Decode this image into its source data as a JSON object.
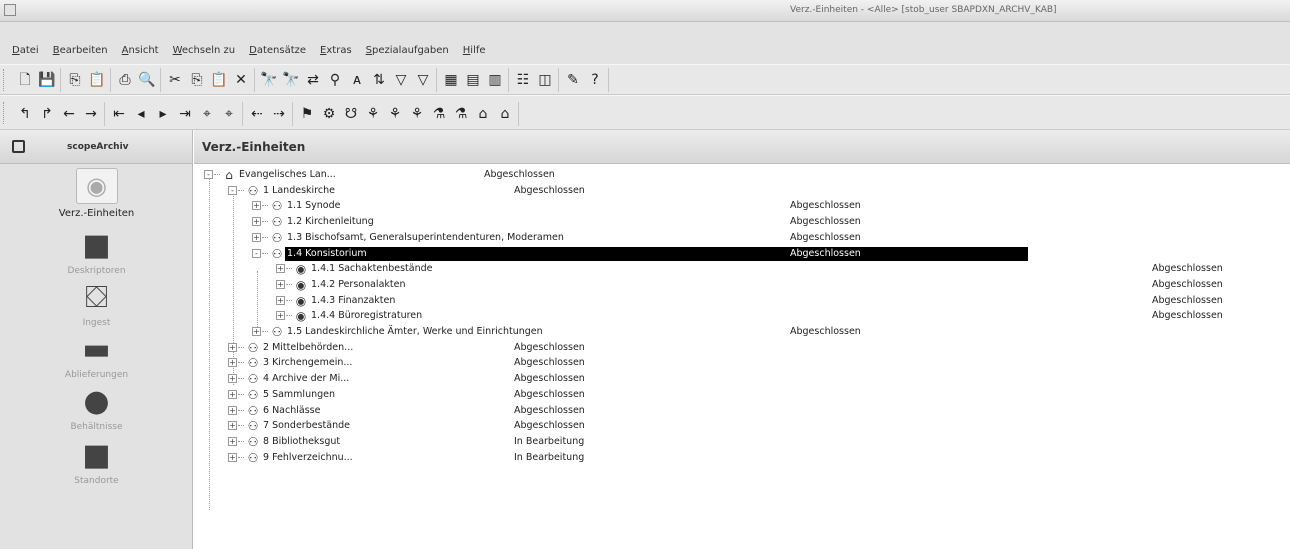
{
  "window": {
    "title": "Verz.-Einheiten - <Alle> [stob_user SBAPDXN_ARCHV_KAB]"
  },
  "menu": [
    "Datei",
    "Bearbeiten",
    "Ansicht",
    "Wechseln zu",
    "Datensätze",
    "Extras",
    "Spezialaufgaben",
    "Hilfe"
  ],
  "toolbar1": {
    "groups": [
      [
        "new-icon",
        "save-icon"
      ],
      [
        "copy-icon",
        "paste-icon"
      ],
      [
        "print-icon",
        "preview-icon"
      ],
      [
        "cut-icon",
        "copy2-icon",
        "paste2-icon",
        "delete-icon"
      ],
      [
        "find-icon",
        "find-next-icon",
        "replace-icon",
        "filter-icon",
        "find-special-icon",
        "sort-icon",
        "filter2-icon",
        "filter3-icon"
      ],
      [
        "view1-icon",
        "view2-icon",
        "view3-icon"
      ],
      [
        "properties-icon",
        "window-icon"
      ],
      [
        "tool-icon",
        "help-icon"
      ]
    ]
  },
  "toolbar2": {
    "groups": [
      [
        "level-up-icon",
        "level-down-icon",
        "arrow-left-icon",
        "arrow-right-icon"
      ],
      [
        "first-icon",
        "prev-icon",
        "next-icon",
        "last-icon",
        "goto-icon",
        "goto2-icon"
      ],
      [
        "back-icon",
        "forward-icon"
      ],
      [
        "tool1-icon",
        "tool2-icon",
        "tool3-icon",
        "tool4-icon",
        "tool5-icon",
        "tool6-icon",
        "tool7-icon",
        "tool8-icon",
        "tool9-icon",
        "tool10-icon"
      ]
    ]
  },
  "sidebar": {
    "header": "scopeArchiv",
    "items": [
      {
        "label": "Verz.-Einheiten",
        "active": true
      },
      {
        "label": "Deskriptoren",
        "active": false
      },
      {
        "label": "Ingest",
        "active": false
      },
      {
        "label": "Ablieferungen",
        "active": false
      },
      {
        "label": "Behältnisse",
        "active": false
      },
      {
        "label": "Standorte",
        "active": false
      }
    ]
  },
  "main": {
    "title": "Verz.-Einheiten",
    "rows": [
      {
        "label": "Evangelisches Lan...",
        "status": "Abgeschlossen",
        "level": 0,
        "expander": "-",
        "icon": "archive"
      },
      {
        "label": "1  Landeskirche",
        "status": "Abgeschlossen",
        "level": 1,
        "expander": "-",
        "icon": "group"
      },
      {
        "label": "1.1  Synode",
        "status": "Abgeschlossen",
        "level": 2,
        "expander": "+",
        "icon": "group"
      },
      {
        "label": "1.2  Kirchenleitung",
        "status": "Abgeschlossen",
        "level": 2,
        "expander": "+",
        "icon": "group"
      },
      {
        "label": "1.3  Bischofsamt, Generalsuperintendenturen, Moderamen",
        "status": "Abgeschlossen",
        "level": 2,
        "expander": "+",
        "icon": "group"
      },
      {
        "label": "1.4  Konsistorium",
        "status": "Abgeschlossen",
        "level": 2,
        "expander": "-",
        "icon": "group",
        "selected": true
      },
      {
        "label": "1.4.1  Sachaktenbestände",
        "status": "Abgeschlossen",
        "level": 3,
        "expander": "+",
        "icon": "file"
      },
      {
        "label": "1.4.2  Personalakten",
        "status": "Abgeschlossen",
        "level": 3,
        "expander": "+",
        "icon": "file"
      },
      {
        "label": "1.4.3  Finanzakten",
        "status": "Abgeschlossen",
        "level": 3,
        "expander": "+",
        "icon": "file"
      },
      {
        "label": "1.4.4  Büroregistraturen",
        "status": "Abgeschlossen",
        "level": 3,
        "expander": "+",
        "icon": "file"
      },
      {
        "label": "1.5  Landeskirchliche Ämter, Werke und Einrichtungen",
        "status": "Abgeschlossen",
        "level": 2,
        "expander": "+",
        "icon": "group"
      },
      {
        "label": "2  Mittelbehörden...",
        "status": "Abgeschlossen",
        "level": 1,
        "expander": "+",
        "icon": "group"
      },
      {
        "label": "3  Kirchengemein...",
        "status": "Abgeschlossen",
        "level": 1,
        "expander": "+",
        "icon": "group"
      },
      {
        "label": "4  Archive der Mi...",
        "status": "Abgeschlossen",
        "level": 1,
        "expander": "+",
        "icon": "group"
      },
      {
        "label": "5  Sammlungen",
        "status": "Abgeschlossen",
        "level": 1,
        "expander": "+",
        "icon": "group"
      },
      {
        "label": "6  Nachlässe",
        "status": "Abgeschlossen",
        "level": 1,
        "expander": "+",
        "icon": "group"
      },
      {
        "label": "7  Sonderbestände",
        "status": "Abgeschlossen",
        "level": 1,
        "expander": "+",
        "icon": "group"
      },
      {
        "label": "8  Bibliotheksgut",
        "status": "In Bearbeitung",
        "level": 1,
        "expander": "+",
        "icon": "group"
      },
      {
        "label": "9  Fehlverzeichnu...",
        "status": "In Bearbeitung",
        "level": 1,
        "expander": "+",
        "icon": "group"
      }
    ]
  }
}
